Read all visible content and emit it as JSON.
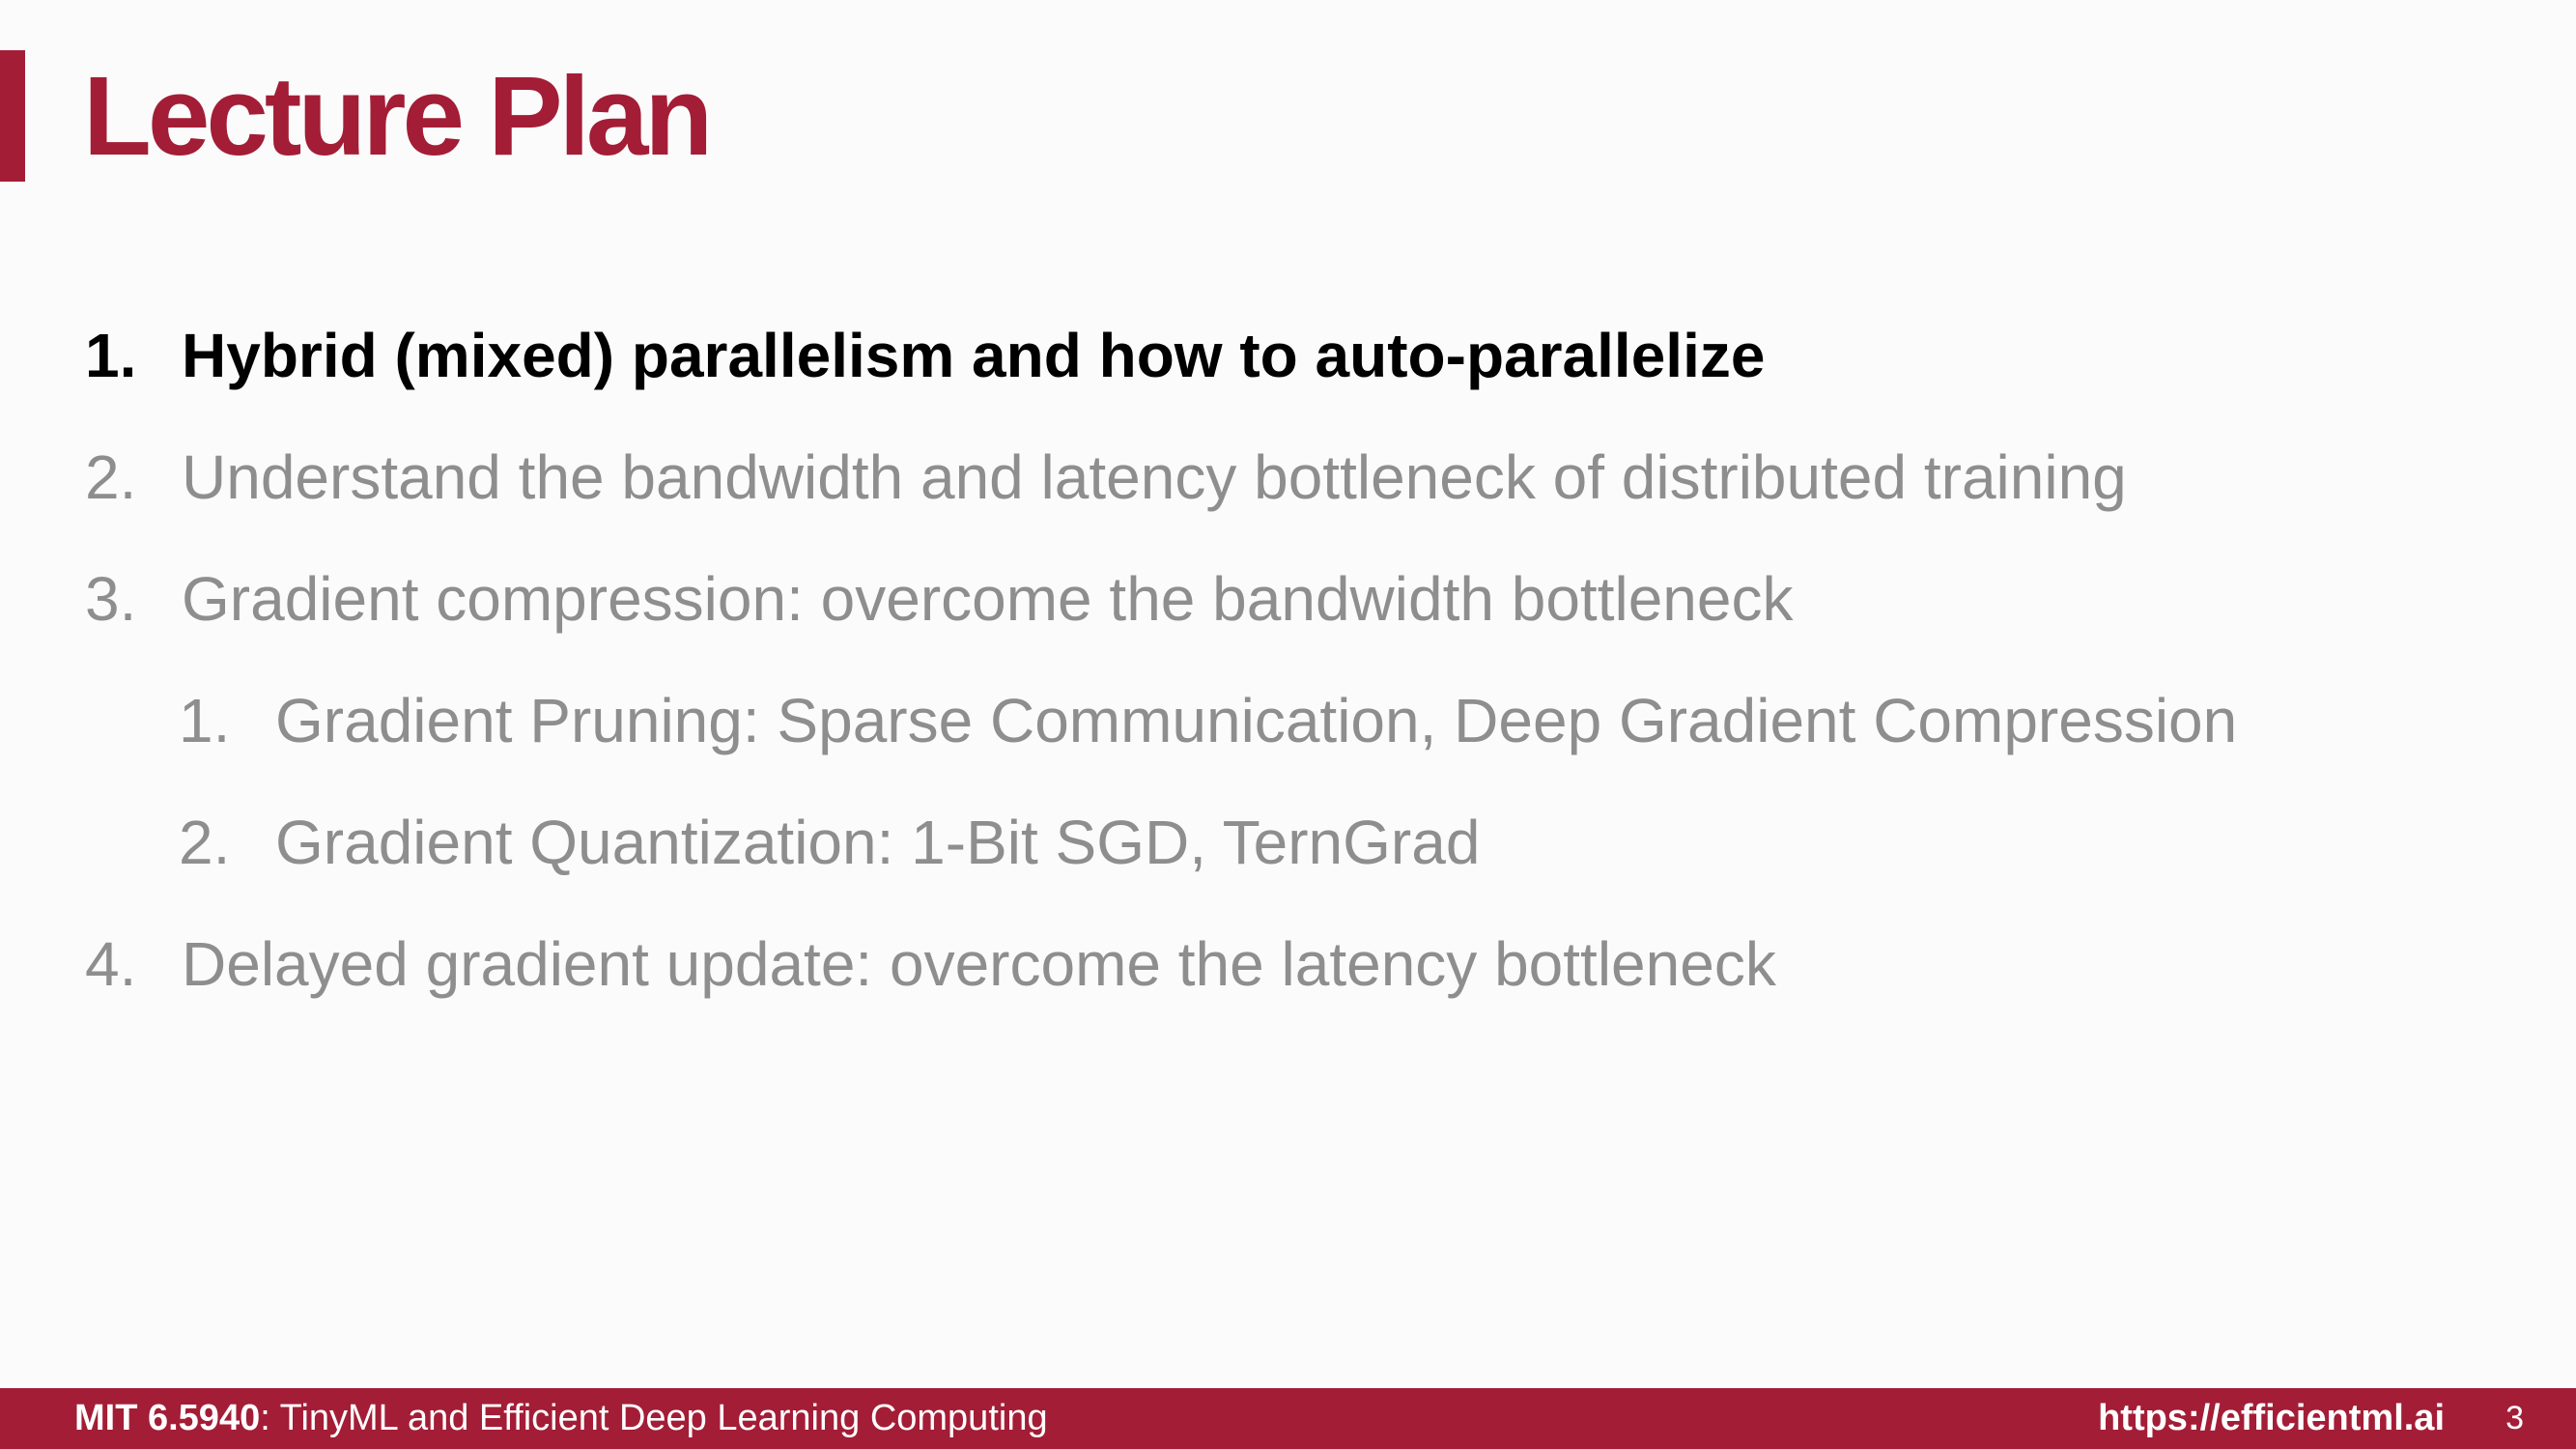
{
  "slide": {
    "title": "Lecture Plan",
    "brand_color": "#a31d36"
  },
  "plan": {
    "items": [
      {
        "number": "1.",
        "text": "Hybrid (mixed) parallelism and how to auto-parallelize",
        "current": true
      },
      {
        "number": "2.",
        "text": "Understand the bandwidth and latency bottleneck of distributed training",
        "current": false
      },
      {
        "number": "3.",
        "text": "Gradient compression: overcome the bandwidth bottleneck",
        "current": false
      },
      {
        "number": "1.",
        "text": "Gradient Pruning: Sparse Communication, Deep Gradient Compression",
        "current": false
      },
      {
        "number": "2.",
        "text": "Gradient Quantization: 1-Bit SGD, TernGrad",
        "current": false
      },
      {
        "number": "4.",
        "text": "Delayed gradient update: overcome the latency bottleneck",
        "current": false
      }
    ]
  },
  "footer": {
    "course_code": "MIT 6.5940",
    "course_title": ": TinyML and Efficient Deep Learning Computing",
    "url": "https://efficientml.ai",
    "page_number": "3"
  }
}
